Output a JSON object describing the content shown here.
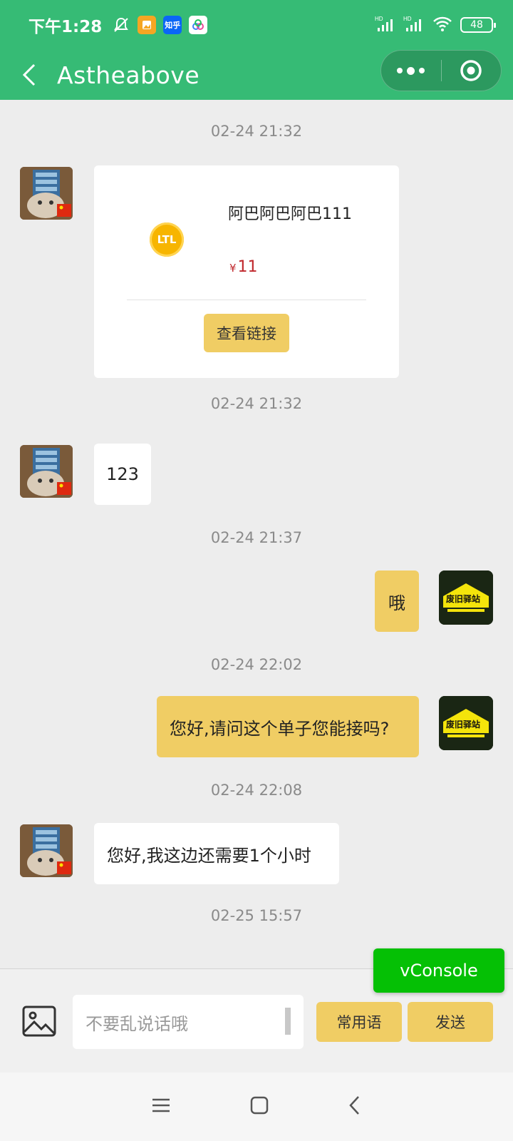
{
  "status_bar": {
    "time": "下午1:28",
    "zhihu_label": "知乎",
    "battery": "48"
  },
  "header": {
    "title": "Astheabove"
  },
  "colors": {
    "header_bg": "#36bb75",
    "my_bubble": "#f0cd64",
    "vconsole": "#05c005",
    "price": "#c0282d"
  },
  "messages": [
    {
      "timestamp": "02-24 21:32",
      "side": "left",
      "type": "product-card",
      "product": {
        "coin_label": "LTL",
        "title": "阿巴阿巴阿巴111",
        "currency": "¥",
        "price": "11",
        "link_label": "查看链接"
      }
    },
    {
      "timestamp": "02-24 21:32",
      "side": "left",
      "text": "123"
    },
    {
      "timestamp": "02-24 21:37",
      "side": "right",
      "text": "哦"
    },
    {
      "timestamp": "02-24 22:02",
      "side": "right",
      "text": "您好,请问这个单子您能接吗?"
    },
    {
      "timestamp": "02-24 22:08",
      "side": "left",
      "text": "您好,我这边还需要1个小时"
    },
    {
      "timestamp": "02-25 15:57"
    }
  ],
  "store_avatar_text": "废旧驿站",
  "input": {
    "placeholder": "不要乱说话哦",
    "phrases_label": "常用语",
    "send_label": "发送"
  },
  "vconsole_label": "vConsole"
}
